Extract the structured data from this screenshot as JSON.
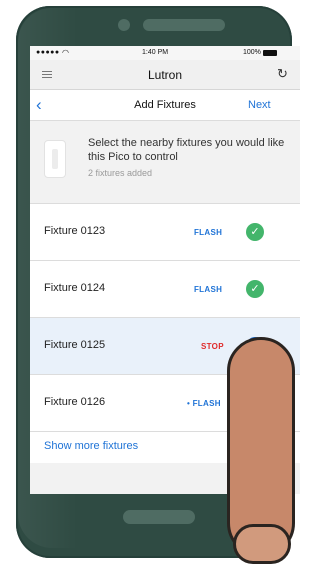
{
  "status_bar": {
    "carrier": "●●●●● ",
    "time": "1:40 PM",
    "battery": "100%"
  },
  "browser": {
    "title": "Lutron"
  },
  "nav": {
    "title": "Add Fixtures",
    "next": "Next"
  },
  "info": {
    "instruction": "Select the nearby fixtures you would like this Pico to control",
    "subtext": "2 fixtures added"
  },
  "fixtures": [
    {
      "name": "Fixture 0123",
      "action": "FLASH",
      "state": "added"
    },
    {
      "name": "Fixture 0124",
      "action": "FLASH",
      "state": "added"
    },
    {
      "name": "Fixture 0125",
      "action": "STOP",
      "state": "selected"
    },
    {
      "name": "Fixture 0126",
      "action": "• FLASH",
      "state": "available"
    }
  ],
  "show_more": "Show more fixtures",
  "colors": {
    "accent": "#1f73d6",
    "added": "#43b56b",
    "stop": "#e02b2b",
    "device": "#2f4b43"
  }
}
